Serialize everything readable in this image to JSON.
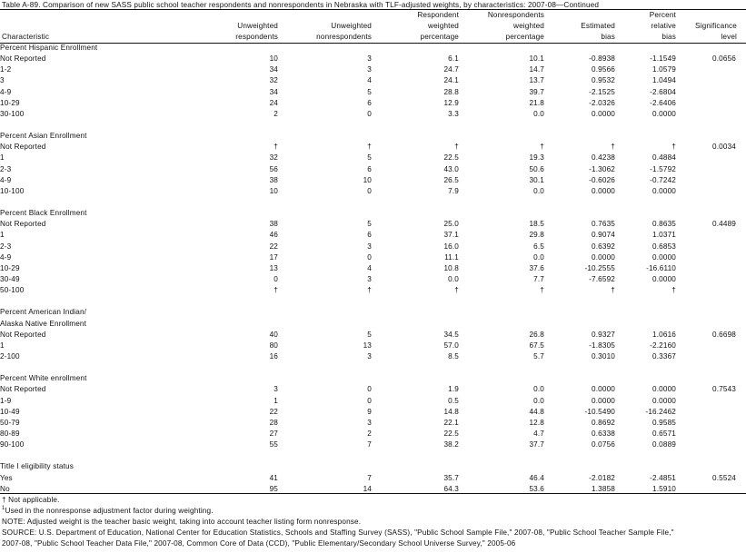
{
  "title": "Table A-89. Comparison of new SASS public school teacher respondents and nonrespondents in Nebraska with TLF-adjusted weights, by characteristics: 2007-08—Continued",
  "headers": {
    "characteristic": [
      "Characteristic"
    ],
    "unweighted_respondents": [
      "Unweighted",
      "respondents"
    ],
    "unweighted_nonrespondents": [
      "Unweighted",
      "nonrespondents"
    ],
    "respondent_weighted_pct": [
      "Respondent",
      "weighted",
      "percentage"
    ],
    "nonrespondents_weighted_pct": [
      "Nonrespondents",
      "weighted",
      "percentage"
    ],
    "estimated_bias": [
      "Estimated",
      "bias"
    ],
    "percent_relative_bias": [
      "Percent",
      "relative",
      "bias"
    ],
    "significance_level": [
      "Significance",
      "level"
    ]
  },
  "sections": [
    {
      "label": "Percent Hispanic Enrollment",
      "rows": [
        {
          "label": "Not Reported",
          "cells": [
            "10",
            "3",
            "6.1",
            "10.1",
            "-0.8938",
            "-1.1549",
            "0.0656"
          ]
        },
        {
          "label": "1-2",
          "cells": [
            "34",
            "3",
            "24.7",
            "14.7",
            "0.9566",
            "1.0579",
            ""
          ]
        },
        {
          "label": "3",
          "cells": [
            "32",
            "4",
            "24.1",
            "13.7",
            "0.9532",
            "1.0494",
            ""
          ]
        },
        {
          "label": "4-9",
          "cells": [
            "34",
            "5",
            "28.8",
            "39.7",
            "-2.1525",
            "-2.6804",
            ""
          ]
        },
        {
          "label": "10-29",
          "cells": [
            "24",
            "6",
            "12.9",
            "21.8",
            "-2.0326",
            "-2.6406",
            ""
          ]
        },
        {
          "label": "30-100",
          "cells": [
            "2",
            "0",
            "3.3",
            "0.0",
            "0.0000",
            "0.0000",
            ""
          ]
        }
      ]
    },
    {
      "label": "Percent Asian Enrollment",
      "rows": [
        {
          "label": "Not Reported",
          "cells": [
            "†",
            "†",
            "†",
            "†",
            "†",
            "†",
            "0.0034"
          ]
        },
        {
          "label": "1",
          "cells": [
            "32",
            "5",
            "22.5",
            "19.3",
            "0.4238",
            "0.4884",
            ""
          ]
        },
        {
          "label": "2-3",
          "cells": [
            "56",
            "6",
            "43.0",
            "50.6",
            "-1.3062",
            "-1.5792",
            ""
          ]
        },
        {
          "label": "4-9",
          "cells": [
            "38",
            "10",
            "26.5",
            "30.1",
            "-0.6026",
            "-0.7242",
            ""
          ]
        },
        {
          "label": "10-100",
          "cells": [
            "10",
            "0",
            "7.9",
            "0.0",
            "0.0000",
            "0.0000",
            ""
          ]
        }
      ]
    },
    {
      "label": "Percent Black Enrollment",
      "rows": [
        {
          "label": "Not Reported",
          "cells": [
            "38",
            "5",
            "25.0",
            "18.5",
            "0.7635",
            "0.8635",
            "0.4489"
          ]
        },
        {
          "label": "1",
          "cells": [
            "46",
            "6",
            "37.1",
            "29.8",
            "0.9074",
            "1.0371",
            ""
          ]
        },
        {
          "label": "2-3",
          "cells": [
            "22",
            "3",
            "16.0",
            "6.5",
            "0.6392",
            "0.6853",
            ""
          ]
        },
        {
          "label": "4-9",
          "cells": [
            "17",
            "0",
            "11.1",
            "0.0",
            "0.0000",
            "0.0000",
            ""
          ]
        },
        {
          "label": "10-29",
          "cells": [
            "13",
            "4",
            "10.8",
            "37.6",
            "-10.2555",
            "-16.6110",
            ""
          ]
        },
        {
          "label": "30-49",
          "cells": [
            "0",
            "3",
            "0.0",
            "7.7",
            "-7.6592",
            "0.0000",
            ""
          ]
        },
        {
          "label": "50-100",
          "cells": [
            "†",
            "†",
            "†",
            "†",
            "†",
            "†",
            ""
          ]
        }
      ]
    },
    {
      "label": "Percent American Indian/",
      "label2": "Alaska Native Enrollment",
      "rows": [
        {
          "label": "Not Reported",
          "cells": [
            "40",
            "5",
            "34.5",
            "26.8",
            "0.9327",
            "1.0616",
            "0.6698"
          ]
        },
        {
          "label": "1",
          "cells": [
            "80",
            "13",
            "57.0",
            "67.5",
            "-1.8305",
            "-2.2160",
            ""
          ]
        },
        {
          "label": "2-100",
          "cells": [
            "16",
            "3",
            "8.5",
            "5.7",
            "0.3010",
            "0.3367",
            ""
          ]
        }
      ]
    },
    {
      "label": "Percent White enrollment",
      "rows": [
        {
          "label": "Not Reported",
          "cells": [
            "3",
            "0",
            "1.9",
            "0.0",
            "0.0000",
            "0.0000",
            "0.7543"
          ]
        },
        {
          "label": "1-9",
          "cells": [
            "1",
            "0",
            "0.5",
            "0.0",
            "0.0000",
            "0.0000",
            ""
          ]
        },
        {
          "label": "10-49",
          "cells": [
            "22",
            "9",
            "14.8",
            "44.8",
            "-10.5490",
            "-16.2462",
            ""
          ]
        },
        {
          "label": "50-79",
          "cells": [
            "28",
            "3",
            "22.1",
            "12.8",
            "0.8692",
            "0.9585",
            ""
          ]
        },
        {
          "label": "80-89",
          "cells": [
            "27",
            "2",
            "22.5",
            "4.7",
            "0.6338",
            "0.6571",
            ""
          ]
        },
        {
          "label": "90-100",
          "cells": [
            "55",
            "7",
            "38.2",
            "37.7",
            "0.0756",
            "0.0889",
            ""
          ]
        }
      ]
    },
    {
      "label": "Title I eligibility status",
      "rows": [
        {
          "label": "Yes",
          "cells": [
            "41",
            "7",
            "35.7",
            "46.4",
            "-2.0182",
            "-2.4851",
            "0.5524"
          ]
        },
        {
          "label": "No",
          "cells": [
            "95",
            "14",
            "64.3",
            "53.6",
            "1.3858",
            "1.5910",
            ""
          ]
        }
      ]
    }
  ],
  "notes": {
    "not_applicable": "† Not applicable.",
    "footnote_1_marker": "1",
    "footnote_1_text": "Used in the nonresponse adjustment factor during weighting.",
    "note": "NOTE: Adjusted weight is the teacher basic weight, taking into account teacher listing form nonresponse.",
    "source_1": "SOURCE: U.S. Department of Education, National Center for Education Statistics, Schools and Staffing Survey (SASS), \"Public School Sample File,\" 2007-08, \"Public School Teacher Sample File,\"",
    "source_2": "2007-08, \"Public School Teacher Data File,\" 2007-08, Common Core of Data (CCD), \"Public Elementary/Secondary School Universe Survey,\" 2005-06"
  }
}
